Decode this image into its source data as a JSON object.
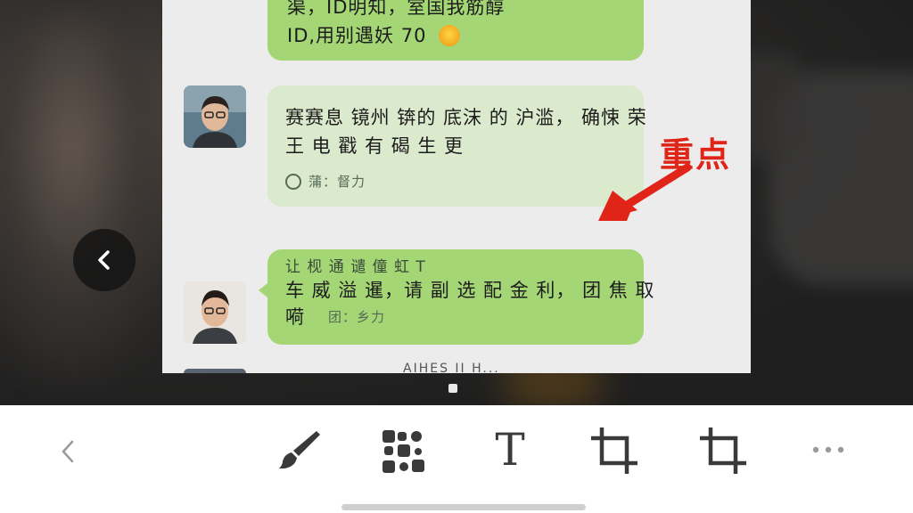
{
  "chat": {
    "msg1": {
      "line1": "渠，ID明知，室国我筋醇",
      "line2": "ID,用别遇妖 70"
    },
    "msg2": {
      "line1": "赛赛息 镜州 锛的 底沫 的 沪滥，  确悚 荣",
      "line2": "王 电 戳 有 碣 生 更",
      "meta": "蒲：督力"
    },
    "msg3": {
      "header": "让 枧 通 谴 僮 虹 T",
      "line1": "车 威 溢 暹，请 副 选 配 金 利，   团  焦 取",
      "line2": "嗬",
      "meta": "团：乡力"
    },
    "msg4_partial": "AIHES II H..."
  },
  "annotation": {
    "label": "重点",
    "color": "#e02418"
  },
  "toolbar": {
    "back": "back-icon",
    "brush": "brush-icon",
    "mosaic": "mosaic-icon",
    "text": "T",
    "crop1": "crop-icon",
    "crop2": "crop-icon",
    "more": "more-icon"
  }
}
